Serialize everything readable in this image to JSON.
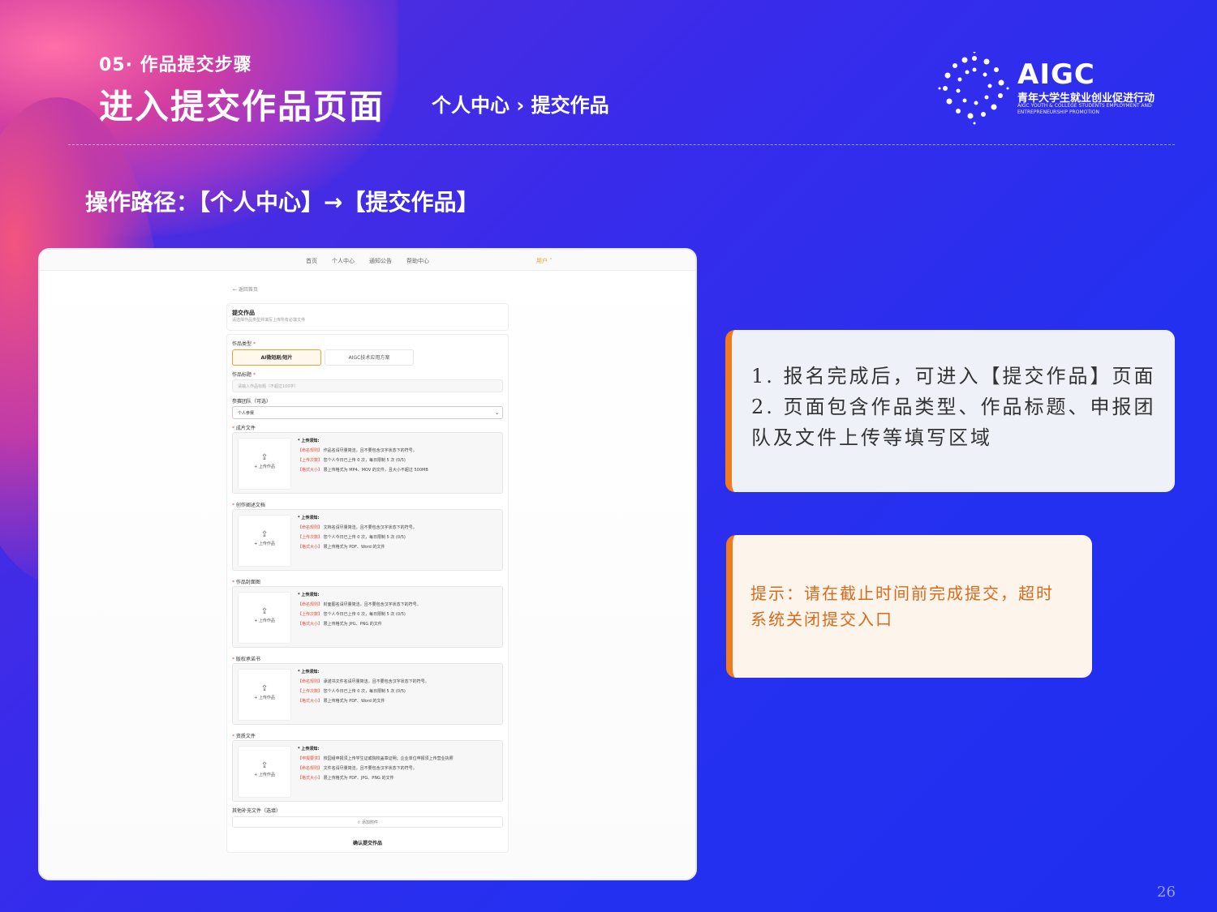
{
  "slide": {
    "section_label": "05· 作品提交步骤",
    "title": "进入提交作品页面",
    "crumb": "个人中心 › 提交作品",
    "path": "操作路径：【个人中心】→【提交作品】",
    "page_number": "26"
  },
  "logo": {
    "brand": "AIGC",
    "cn_name": "青年大学生就业创业促进行动",
    "en_name": "AIGC YOUTH & COLLEGE STUDENTS EMPLOYMENT AND ENTREPRENEURSHIP PROMOTION",
    "icon": "dotted-ring-icon"
  },
  "screenshot": {
    "nav": [
      "首页",
      "个人中心",
      "通知公告",
      "帮助中心"
    ],
    "user_label": "用户 ˅",
    "back_link": "← 返回首页",
    "header_title": "提交作品",
    "header_sub": "请选择作品类型并填写上传所有必填文件",
    "type_label": "作品类型",
    "tabs": [
      "AI微短剧/短片",
      "AIGC技术应用方案"
    ],
    "title_label": "作品标题",
    "title_placeholder": "请输入作品标题（不超过100字）",
    "team_label": "参赛团队（可选）",
    "team_value": "个人参赛",
    "upload_btn": "+ 上传作品",
    "upload_icon": "upload-icon",
    "info_heading": "* 上传须知:",
    "sections": [
      {
        "label": "成片文件",
        "lines": [
          [
            "【命名规则】",
            "作品名请尽量简洁，且不要包含汉字状态下的符号。"
          ],
          [
            "【上传次数】",
            "您个人今日已上传 0 次，每日限制 5 次 (0/5)"
          ],
          [
            "【格式大小】",
            "限上传格式为 MP4、MOV 的文件，且大小不超过 500MB"
          ]
        ]
      },
      {
        "label": "创作阐述文档",
        "lines": [
          [
            "【命名规则】",
            "文档名请尽量简洁，且不要包含汉字状态下的符号。"
          ],
          [
            "【上传次数】",
            "您个人今日已上传 0 次，每日限制 5 次 (0/5)"
          ],
          [
            "【格式大小】",
            "限上传格式为 PDF、Word 的文件"
          ]
        ]
      },
      {
        "label": "作品封面图",
        "lines": [
          [
            "【命名规则】",
            "封面图名请尽量简洁，且不要包含汉字状态下的符号。"
          ],
          [
            "【上传次数】",
            "您个人今日已上传 0 次，每日限制 5 次 (0/5)"
          ],
          [
            "【格式大小】",
            "限上传格式为 JPG、PNG 的文件"
          ]
        ]
      },
      {
        "label": "版权承诺书",
        "lines": [
          [
            "【命名规则】",
            "承诺书文件名请尽量简洁，且不要包含汉字状态下的符号。"
          ],
          [
            "【上传次数】",
            "您个人今日已上传 0 次，每日限制 5 次 (0/5)"
          ],
          [
            "【格式大小】",
            "限上传格式为 PDF、Word 的文件"
          ]
        ]
      },
      {
        "label": "资质文件",
        "lines": [
          [
            "【申报要求】",
            "校园组申报须上传学生证或院校盖章证明；企业单位申报须上传营业执照"
          ],
          [
            "【命名规则】",
            "文件名请尽量简洁，且不要包含汉字状态下的符号。"
          ],
          [
            "【格式大小】",
            "限上传格式为 PDF、JPG、PNG 的文件"
          ]
        ]
      }
    ],
    "extra_label": "其他补充文件（选填）",
    "add_file": "⇪ 添加附件",
    "submit": "确认提交作品"
  },
  "callouts": {
    "steps": "1. 报名完成后，可进入【提交作品】页面 2. 页面包含作品类型、作品标题、申报团队及文件上传等填写区域",
    "tip": "提示：请在截止时间前完成提交，超时系统关闭提交入口"
  },
  "colors": {
    "accent_orange": "#f07a1e",
    "background_blue": "#2430f0",
    "tip_text": "#d96a1c"
  }
}
